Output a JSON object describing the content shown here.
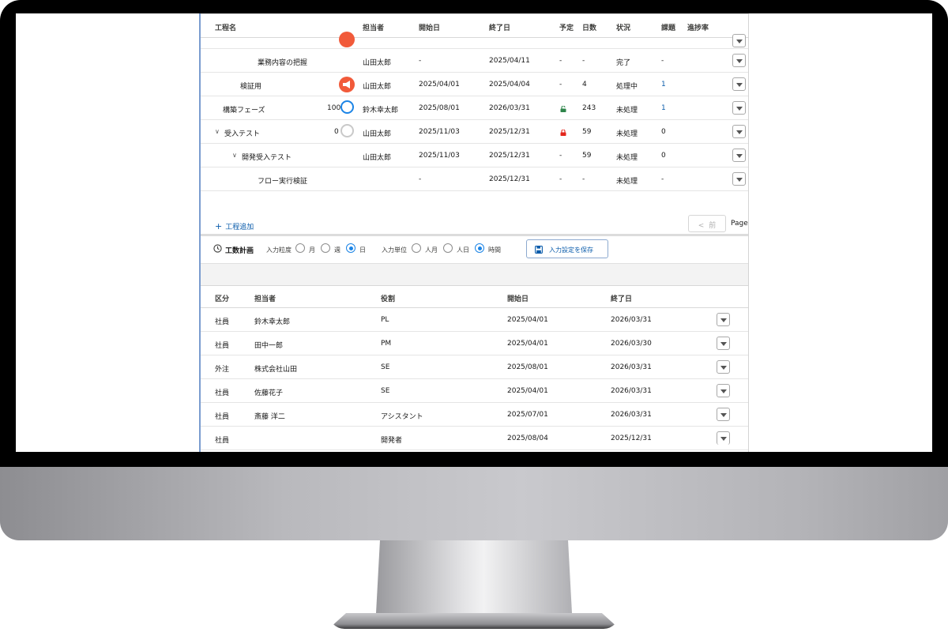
{
  "process_table": {
    "headers": {
      "name": "工程名",
      "assignee": "担当者",
      "start": "開始日",
      "end": "終了日",
      "planned": "予定",
      "days": "日数",
      "status": "状況",
      "issues": "課題",
      "progress": "進捗率"
    },
    "rows": [
      {
        "name": "業務内容の把握",
        "progress": "",
        "assignee": "山田太郎",
        "start": "-",
        "end": "2025/04/11",
        "planned": "-",
        "days": "-",
        "status": "完了",
        "issues": "-"
      },
      {
        "name": "検証用",
        "progress": "",
        "assignee": "山田太郎",
        "start": "2025/04/01",
        "end": "2025/04/04",
        "planned": "-",
        "days": "4",
        "status": "処理中",
        "issues": "1"
      },
      {
        "name": "構築フェーズ",
        "progress": "100",
        "assignee": "鈴木幸太郎",
        "start": "2025/08/01",
        "end": "2026/03/31",
        "planned": "",
        "days": "243",
        "status": "未処理",
        "issues": "1"
      },
      {
        "name": "受入テスト",
        "progress": "0",
        "assignee": "山田太郎",
        "start": "2025/11/03",
        "end": "2025/12/31",
        "planned": "",
        "days": "59",
        "status": "未処理",
        "issues": "0"
      },
      {
        "name": "開発受入テスト",
        "progress": "",
        "assignee": "山田太郎",
        "start": "2025/11/03",
        "end": "2025/12/31",
        "planned": "-",
        "days": "59",
        "status": "未処理",
        "issues": "0"
      },
      {
        "name": "フロー実行検証",
        "progress": "",
        "assignee": "",
        "start": "-",
        "end": "2025/12/31",
        "planned": "-",
        "days": "-",
        "status": "未処理",
        "issues": "-"
      }
    ]
  },
  "add_process": "工程追加",
  "pagination": {
    "prev": "前",
    "page_label": "Page"
  },
  "workload_plan": {
    "title": "工数計画",
    "granularity_label": "入力粒度",
    "granularity_options": [
      "月",
      "週",
      "日"
    ],
    "granularity_selected": "日",
    "unit_label": "入力単位",
    "unit_options": [
      "人月",
      "人日",
      "時間"
    ],
    "unit_selected": "時間",
    "save_button": "入力設定を保存"
  },
  "staff_table": {
    "headers": {
      "category": "区分",
      "assignee": "担当者",
      "role": "役割",
      "start": "開始日",
      "end": "終了日"
    },
    "rows": [
      {
        "category": "社員",
        "assignee": "鈴木幸太郎",
        "role": "PL",
        "start": "2025/04/01",
        "end": "2026/03/31"
      },
      {
        "category": "社員",
        "assignee": "田中一郎",
        "role": "PM",
        "start": "2025/04/01",
        "end": "2026/03/30"
      },
      {
        "category": "外注",
        "assignee": "株式会社山田",
        "role": "SE",
        "start": "2025/08/01",
        "end": "2026/03/31"
      },
      {
        "category": "社員",
        "assignee": "佐藤花子",
        "role": "SE",
        "start": "2025/04/01",
        "end": "2026/03/31"
      },
      {
        "category": "社員",
        "assignee": "斎藤 洋二",
        "role": "アシスタント",
        "start": "2025/07/01",
        "end": "2026/03/31"
      },
      {
        "category": "社員",
        "assignee": "",
        "role": "開発者",
        "start": "2025/08/04",
        "end": "2025/12/31"
      }
    ]
  },
  "colors": {
    "accent": "#0b5cab",
    "badge_orange": "#f15a3a",
    "lock_green": "#2e844a",
    "lock_red": "#e3261c",
    "ring_blue": "#1b84e6"
  }
}
